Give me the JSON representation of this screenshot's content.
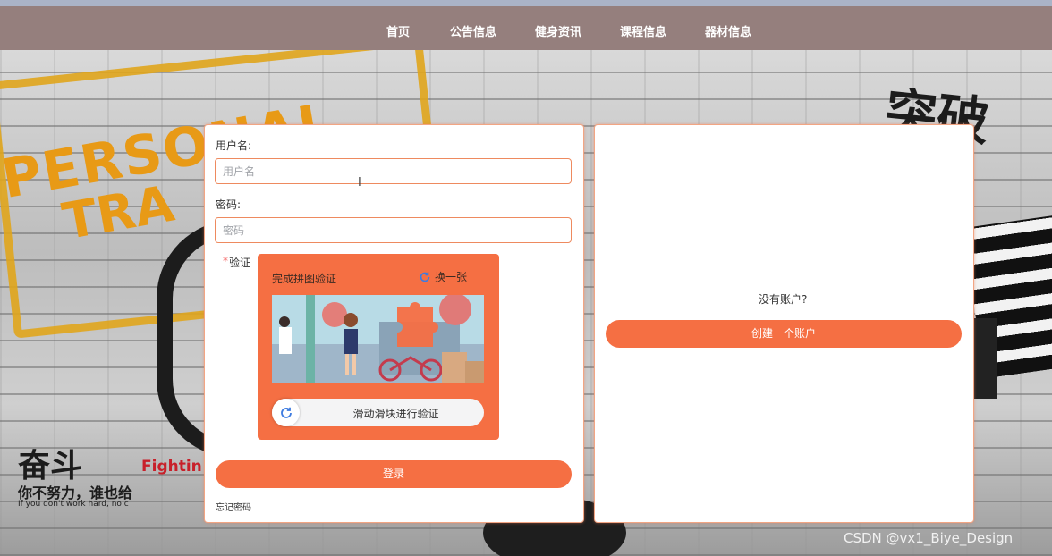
{
  "nav": {
    "items": [
      {
        "label": "首页"
      },
      {
        "label": "公告信息"
      },
      {
        "label": "健身资讯"
      },
      {
        "label": "课程信息"
      },
      {
        "label": "器材信息"
      }
    ]
  },
  "background": {
    "texts": [
      "PERSONAL",
      "TRA",
      "突破",
      "奋斗",
      "Fightin",
      "你不努力，谁也给",
      "If you don't work hard, no c"
    ]
  },
  "login": {
    "username_label": "用户名:",
    "username_placeholder": "用户名",
    "password_label": "密码:",
    "password_placeholder": "密码",
    "verify_required_mark": "*",
    "verify_label": "验证",
    "captcha": {
      "title": "完成拼图验证",
      "refresh_label": "换一张",
      "slider_text": "滑动滑块进行验证"
    },
    "submit_label": "登录",
    "forgot_label": "忘记密码"
  },
  "register": {
    "no_account_text": "没有账户?",
    "create_label": "创建一个账户"
  },
  "watermark": "CSDN @vx1_Biye_Design",
  "colors": {
    "accent": "#f56f43",
    "nav_bg": "#957f7d",
    "border": "#ee8a5f"
  },
  "icons": {
    "refresh": "refresh-icon",
    "slider": "slider-refresh-icon",
    "cursor": "text-cursor-icon"
  }
}
